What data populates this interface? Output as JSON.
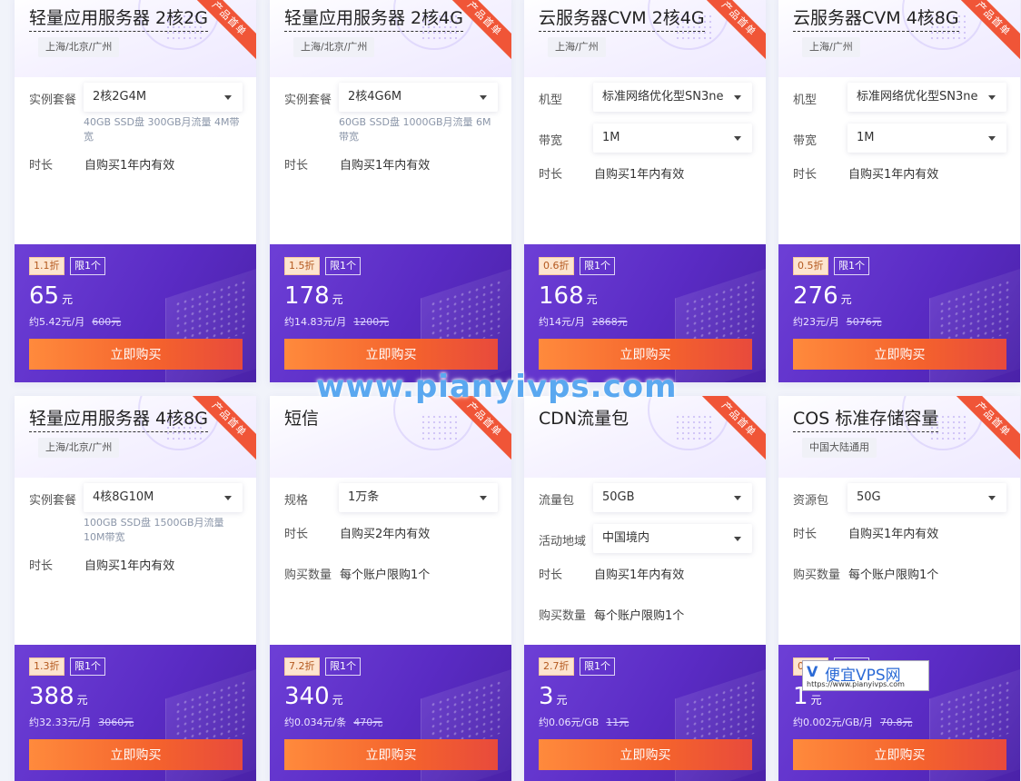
{
  "ribbon_label": "产品首单",
  "buy_label": "立即购买",
  "cards": [
    {
      "title": "轻量应用服务器 2核2G",
      "region": "上海/北京/广州",
      "rows": [
        {
          "label": "实例套餐",
          "select": "2核2G4M",
          "hint": "40GB SSD盘 300GB月流量 4M带宽"
        },
        {
          "label": "时长",
          "value": "自购买1年内有效"
        }
      ],
      "discount": "1.1折",
      "limit": "限1个",
      "price": "65",
      "price_unit": "元",
      "per": "约5.42元/月",
      "original": "600元"
    },
    {
      "title": "轻量应用服务器 2核4G",
      "region": "上海/北京/广州",
      "rows": [
        {
          "label": "实例套餐",
          "select": "2核4G6M",
          "hint": "60GB SSD盘 1000GB月流量 6M带宽"
        },
        {
          "label": "时长",
          "value": "自购买1年内有效"
        }
      ],
      "discount": "1.5折",
      "limit": "限1个",
      "price": "178",
      "price_unit": "元",
      "per": "约14.83元/月",
      "original": "1200元"
    },
    {
      "title": "云服务器CVM 2核4G",
      "region": "上海/广州",
      "rows": [
        {
          "label": "机型",
          "select": "标准网络优化型SN3ne"
        },
        {
          "label": "带宽",
          "select": "1M"
        },
        {
          "label": "时长",
          "value": "自购买1年内有效"
        }
      ],
      "discount": "0.6折",
      "limit": "限1个",
      "price": "168",
      "price_unit": "元",
      "per": "约14元/月",
      "original": "2868元"
    },
    {
      "title": "云服务器CVM 4核8G",
      "region": "上海/广州",
      "rows": [
        {
          "label": "机型",
          "select": "标准网络优化型SN3ne"
        },
        {
          "label": "带宽",
          "select": "1M"
        },
        {
          "label": "时长",
          "value": "自购买1年内有效"
        }
      ],
      "discount": "0.5折",
      "limit": "限1个",
      "price": "276",
      "price_unit": "元",
      "per": "约23元/月",
      "original": "5076元"
    },
    {
      "title": "轻量应用服务器 4核8G",
      "region": "上海/北京/广州",
      "rows": [
        {
          "label": "实例套餐",
          "select": "4核8G10M",
          "hint": "100GB SSD盘 1500GB月流量 10M带宽"
        },
        {
          "label": "时长",
          "value": "自购买1年内有效"
        }
      ],
      "discount": "1.3折",
      "limit": "限1个",
      "price": "388",
      "price_unit": "元",
      "per": "约32.33元/月",
      "original": "3060元"
    },
    {
      "title": "短信",
      "region": "",
      "rows": [
        {
          "label": "规格",
          "select": "1万条"
        },
        {
          "label": "时长",
          "value": "自购买2年内有效"
        },
        {
          "label": "购买数量",
          "value": "每个账户限购1个"
        }
      ],
      "discount": "7.2折",
      "limit": "限1个",
      "price": "340",
      "price_unit": "元",
      "per": "约0.034元/条",
      "original": "470元"
    },
    {
      "title": "CDN流量包",
      "region": "",
      "rows": [
        {
          "label": "流量包",
          "select": "50GB"
        },
        {
          "label": "活动地域",
          "select": "中国境内"
        },
        {
          "label": "时长",
          "value": "自购买1年内有效"
        },
        {
          "label": "购买数量",
          "value": "每个账户限购1个"
        }
      ],
      "discount": "2.7折",
      "limit": "限1个",
      "price": "3",
      "price_unit": "元",
      "per": "约0.06元/GB",
      "original": "11元"
    },
    {
      "title": "COS 标准存储容量",
      "region": "中国大陆通用",
      "rows": [
        {
          "label": "资源包",
          "select": "50G"
        },
        {
          "label": "时长",
          "value": "自购买1年内有效"
        },
        {
          "label": "购买数量",
          "value": "每个账户限购1个"
        }
      ],
      "discount": "0.1折",
      "limit": "限1个",
      "price": "1",
      "price_unit": "元",
      "per": "约0.002元/GB/月",
      "original": "70.8元"
    }
  ],
  "watermark": "www.pianyivps.com",
  "logo": {
    "mark": "V",
    "text": "便宜VPS网",
    "url": "https://www.pianyivps.com"
  }
}
